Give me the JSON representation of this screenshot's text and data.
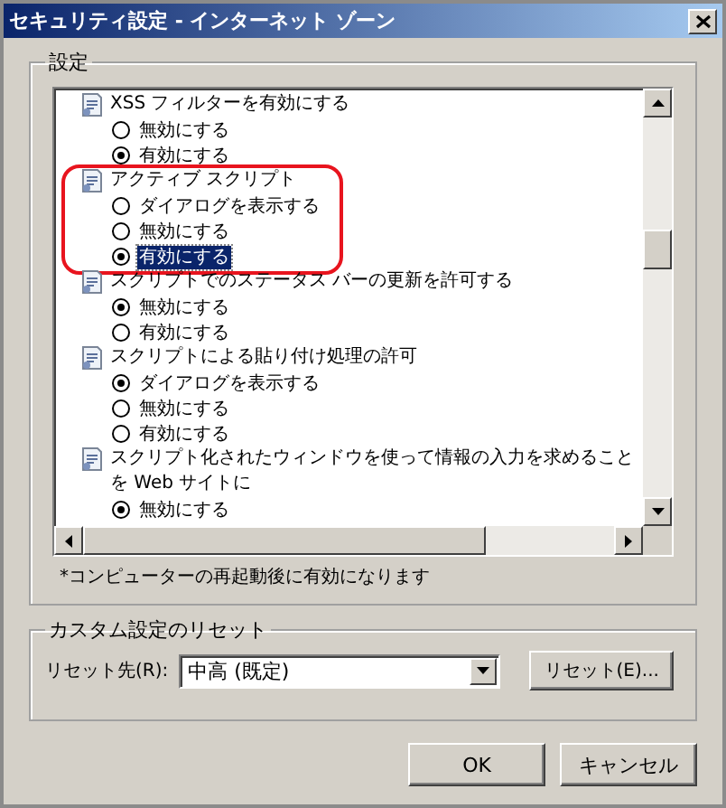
{
  "window": {
    "title": "セキュリティ設定 - インターネット ゾーン"
  },
  "settings_group": {
    "title": "設定",
    "footnote": "*コンピューターの再起動後に有効になります",
    "items": [
      {
        "label": "XSS フィルターを有効にする",
        "annotated": false,
        "options": [
          {
            "label": "無効にする",
            "selected": false,
            "highlighted": false
          },
          {
            "label": "有効にする",
            "selected": true,
            "highlighted": false
          }
        ]
      },
      {
        "label": "アクティブ スクリプト",
        "annotated": true,
        "options": [
          {
            "label": "ダイアログを表示する",
            "selected": false,
            "highlighted": false
          },
          {
            "label": "無効にする",
            "selected": false,
            "highlighted": false
          },
          {
            "label": "有効にする",
            "selected": true,
            "highlighted": true
          }
        ]
      },
      {
        "label": "スクリプトでのステータス バーの更新を許可する",
        "annotated": false,
        "options": [
          {
            "label": "無効にする",
            "selected": true,
            "highlighted": false
          },
          {
            "label": "有効にする",
            "selected": false,
            "highlighted": false
          }
        ]
      },
      {
        "label": "スクリプトによる貼り付け処理の許可",
        "annotated": false,
        "options": [
          {
            "label": "ダイアログを表示する",
            "selected": true,
            "highlighted": false
          },
          {
            "label": "無効にする",
            "selected": false,
            "highlighted": false
          },
          {
            "label": "有効にする",
            "selected": false,
            "highlighted": false
          }
        ]
      },
      {
        "label": "スクリプト化されたウィンドウを使って情報の入力を求めることを Web サイトに",
        "annotated": false,
        "options": [
          {
            "label": "無効にする",
            "selected": true,
            "highlighted": false
          }
        ]
      }
    ]
  },
  "reset_group": {
    "title": "カスタム設定のリセット",
    "label": "リセット先(R):",
    "value": "中高 (既定)",
    "button": "リセット(E)..."
  },
  "buttons": [
    "OK",
    "キャンセル"
  ]
}
